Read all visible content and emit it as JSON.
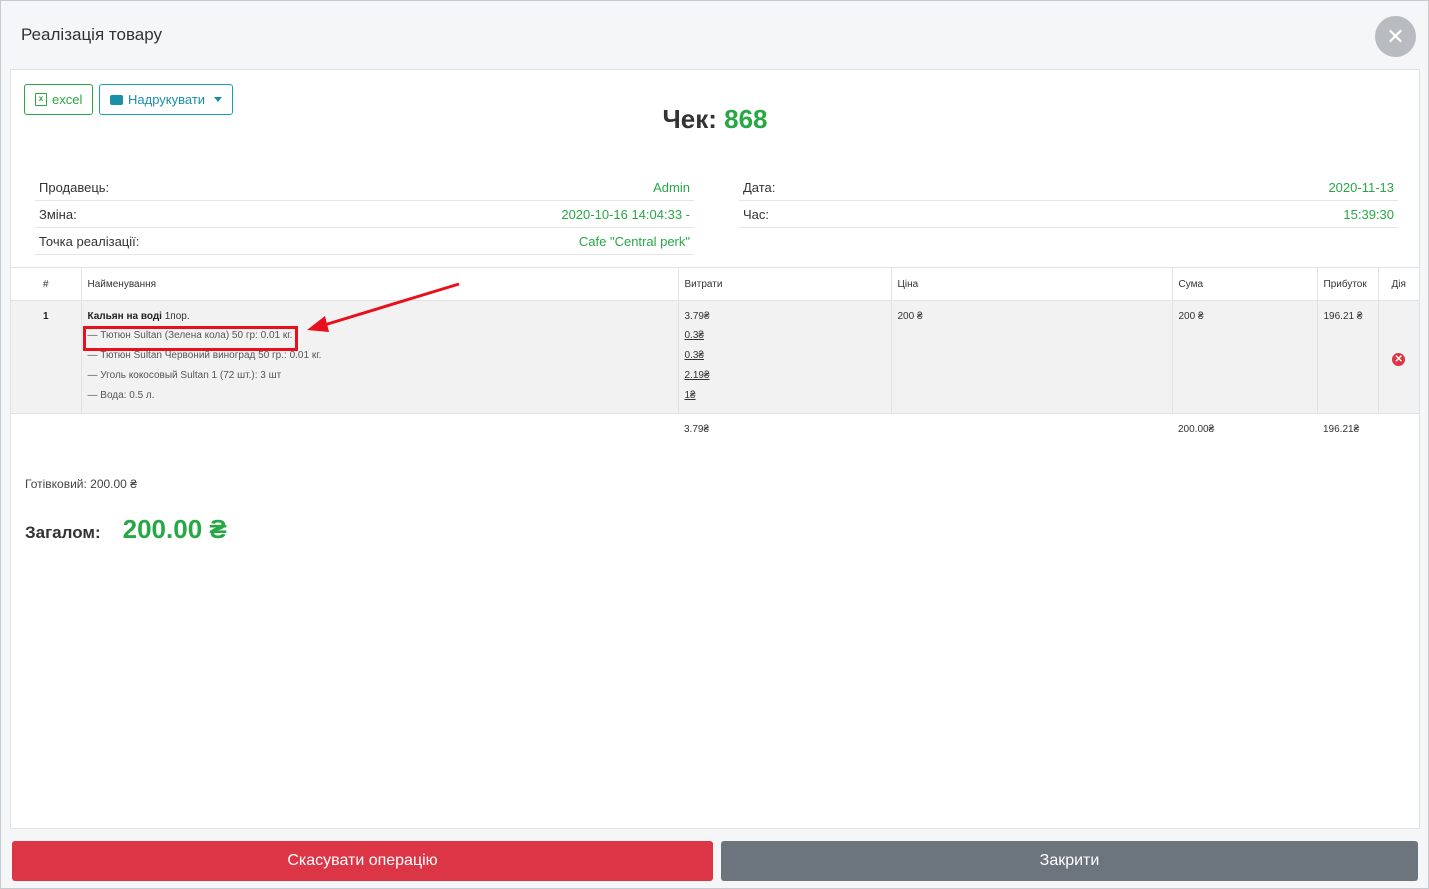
{
  "modal": {
    "title": "Реалізація товару"
  },
  "toolbar": {
    "excel_label": "excel",
    "print_label": "Надрукувати"
  },
  "receipt": {
    "label": "Чек:",
    "number": "868"
  },
  "info_left": [
    {
      "label": "Продавець:",
      "value": "Admin"
    },
    {
      "label": "Зміна:",
      "value": "2020-10-16 14:04:33 -"
    },
    {
      "label": "Точка реалізації:",
      "value": "Cafe \"Central perk\""
    }
  ],
  "info_right": [
    {
      "label": "Дата:",
      "value": "2020-11-13"
    },
    {
      "label": "Час:",
      "value": "15:39:30"
    }
  ],
  "table": {
    "headers": [
      "#",
      "Найменування",
      "Витрати",
      "Ціна",
      "Сума",
      "Прибуток",
      "Дія"
    ],
    "row": {
      "index": "1",
      "name": "Кальян на воді",
      "portion": "1пор.",
      "cost": "3.79₴",
      "price": "200 ₴",
      "sum": "200 ₴",
      "profit": "196.21 ₴",
      "components": [
        {
          "name": "— Тютюн Sultan (Зелена кола) 50 гр: 0.01 кг.",
          "cost": "0.3₴"
        },
        {
          "name": "— Тютюн Sultan Червоний виноград 50 гр.: 0.01 кг.",
          "cost": "0.3₴"
        },
        {
          "name": "— Уголь кокосовый Sultan 1 (72 шт.): 3 шт",
          "cost": "2.19₴"
        },
        {
          "name": "— Вода: 0.5 л.",
          "cost": "1₴"
        }
      ]
    },
    "totals": {
      "cost": "3.79₴",
      "sum": "200.00₴",
      "profit": "196.21₴"
    }
  },
  "payment": {
    "cash": "Готівковий: 200.00 ₴"
  },
  "grand_total": {
    "label": "Загалом:",
    "value": "200.00 ₴"
  },
  "footer": {
    "cancel_label": "Скасувати операцію",
    "close_label": "Закрити"
  },
  "colors": {
    "accent": "#28a745",
    "danger": "#dc3545",
    "secondary": "#6c757d",
    "annotation": "#e8101a"
  }
}
